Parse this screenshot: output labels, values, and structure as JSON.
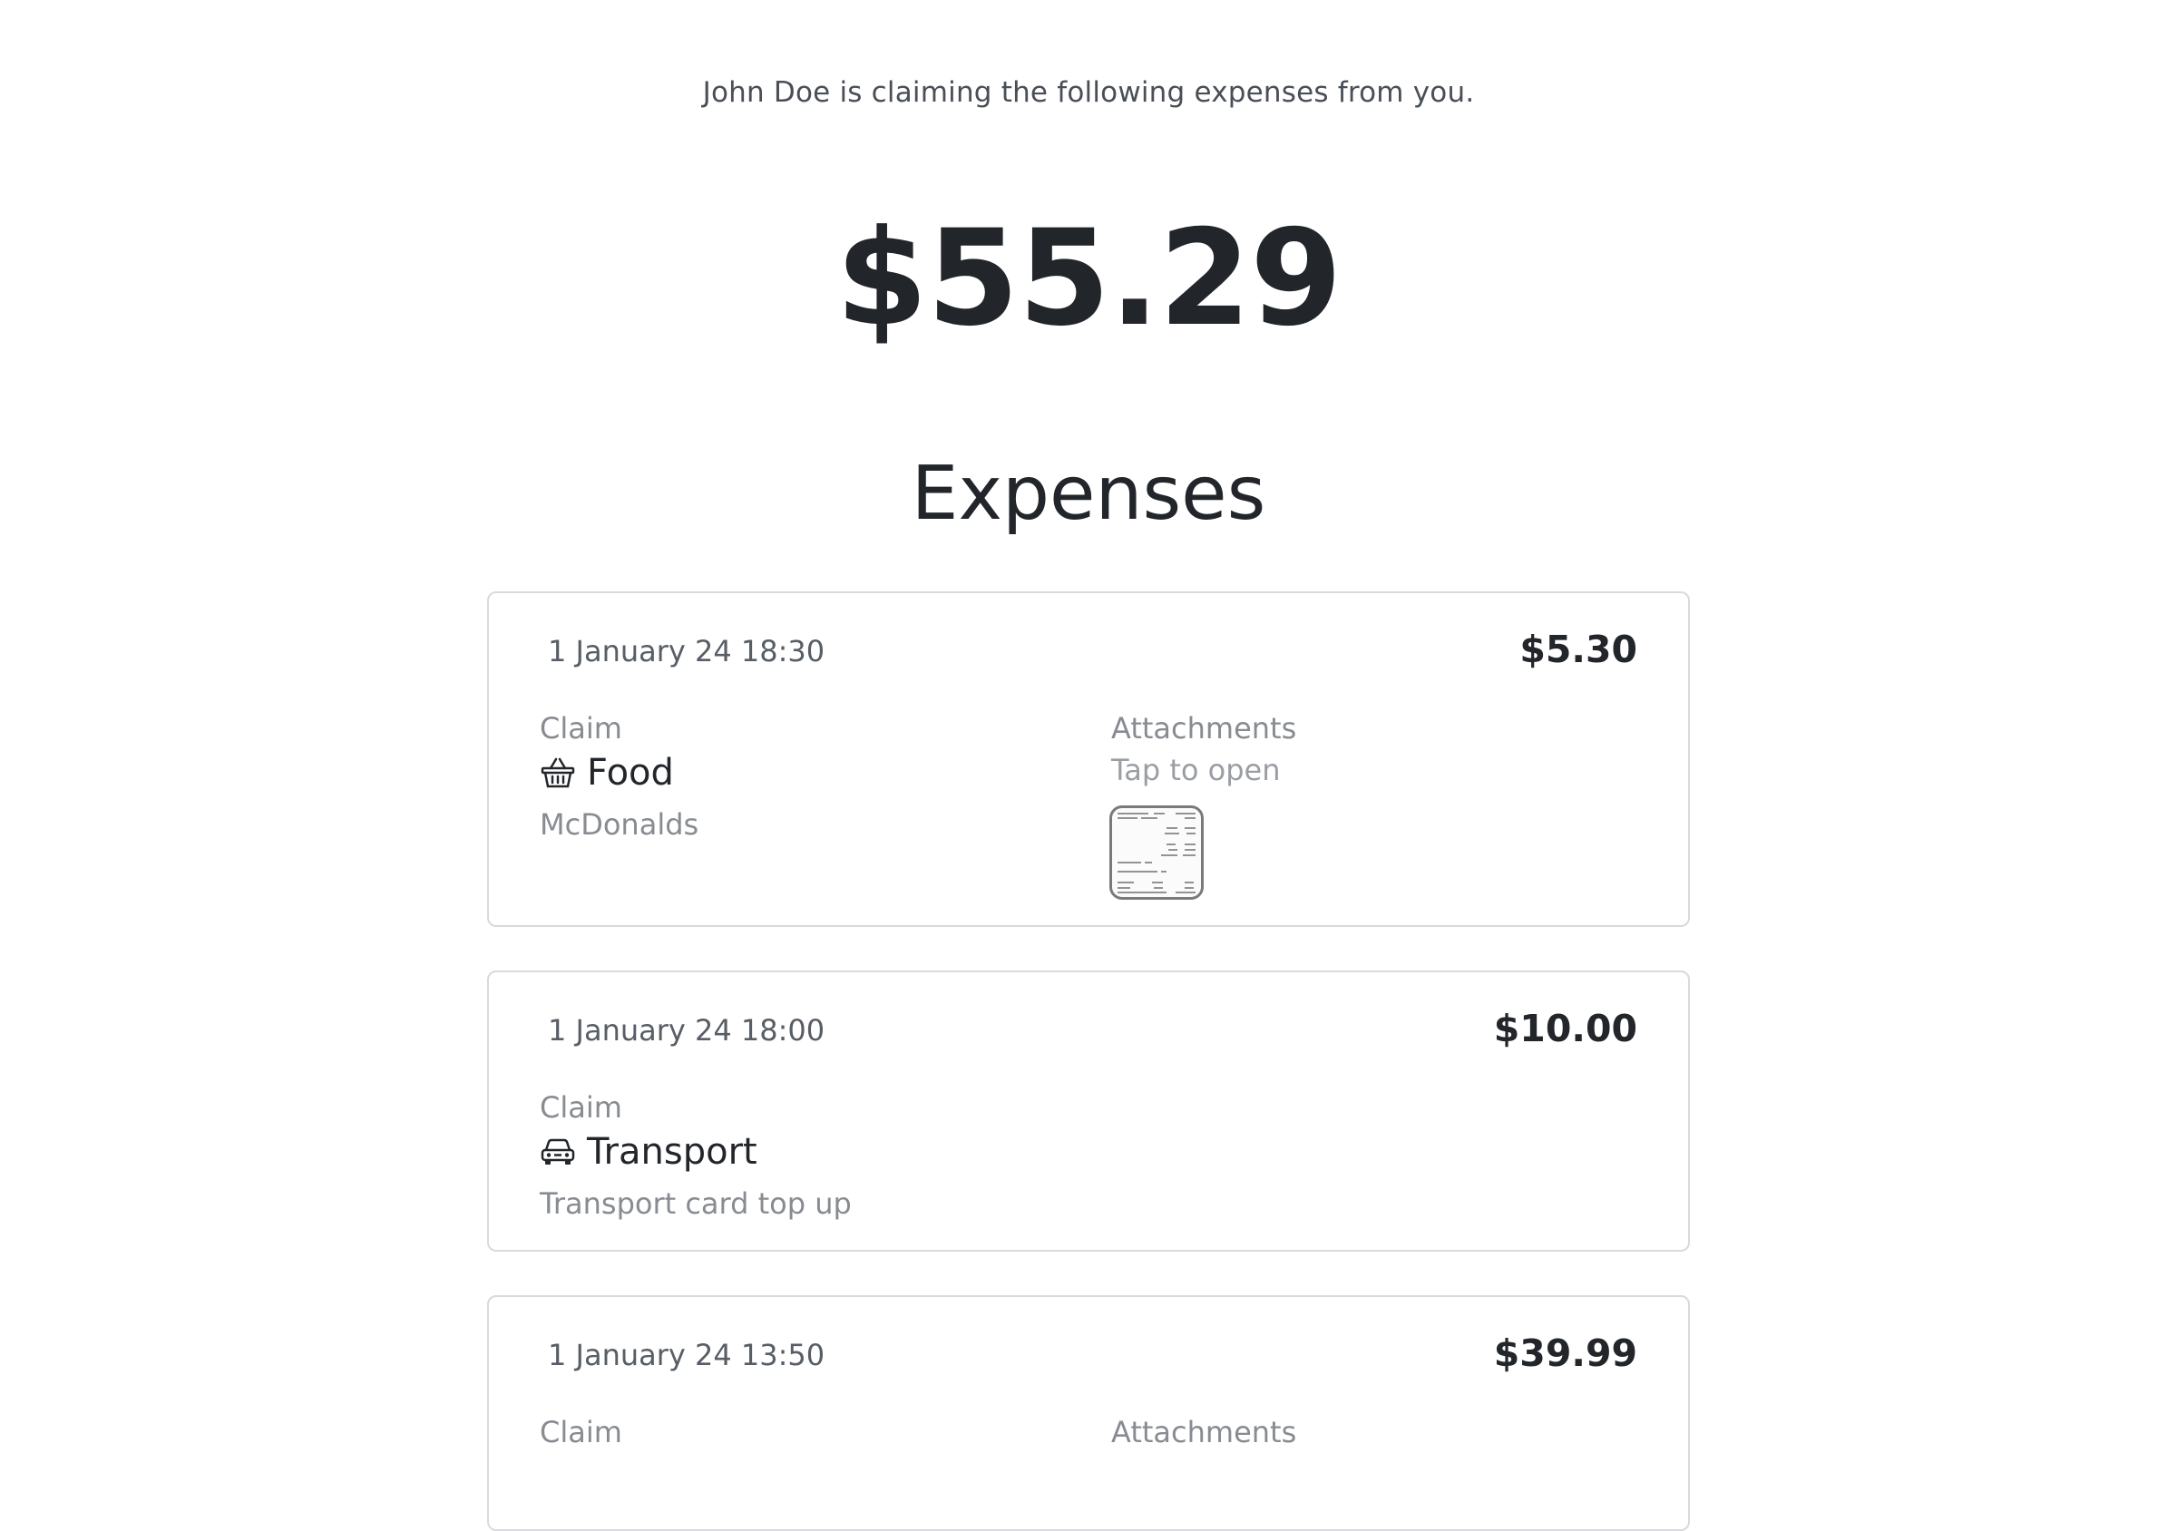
{
  "intro_text": "John Doe is claiming the following expenses from you.",
  "total_amount": "$55.29",
  "section_title": "Expenses",
  "expenses": [
    {
      "date": "1 January 24 18:30",
      "amount": "$5.30",
      "claim_label": "Claim",
      "category": "Food",
      "category_icon": "basket-icon",
      "vendor": "McDonalds",
      "attachments_label": "Attachments",
      "attachments_hint": "Tap to open"
    },
    {
      "date": "1 January 24 18:00",
      "amount": "$10.00",
      "claim_label": "Claim",
      "category": "Transport",
      "category_icon": "car-icon",
      "vendor": "Transport card top up"
    },
    {
      "date": "1 January 24 13:50",
      "amount": "$39.99",
      "claim_label": "Claim",
      "attachments_label": "Attachments"
    }
  ],
  "colors": {
    "text_primary": "#22262b",
    "text_muted": "#888c92",
    "card_border": "#d8dadd"
  }
}
